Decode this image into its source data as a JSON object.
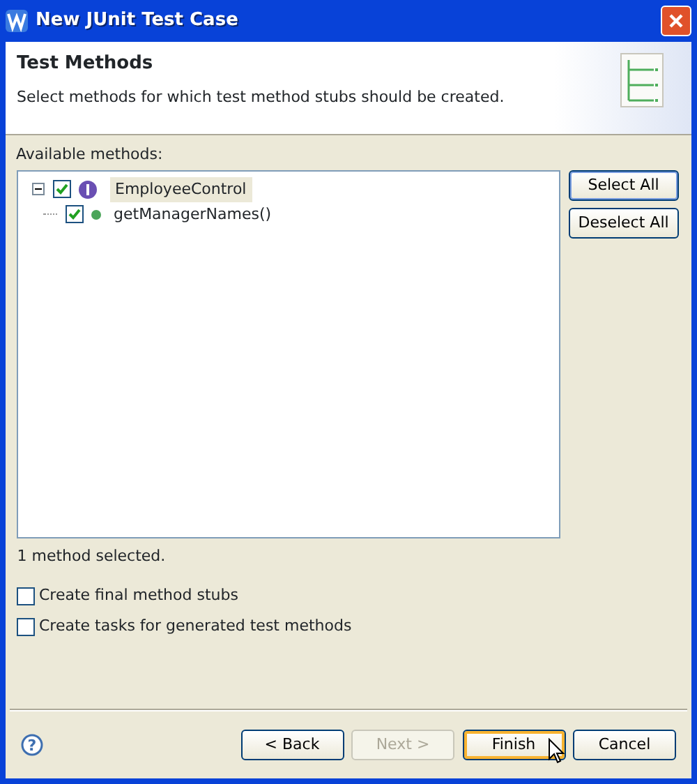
{
  "window": {
    "title": "New JUnit Test Case"
  },
  "header": {
    "title": "Test Methods",
    "description": "Select methods for which test method stubs should be created."
  },
  "methods": {
    "label": "Available methods:",
    "tree": [
      {
        "kind": "interface",
        "label": "EmployeeControl",
        "checked": true,
        "expanded": true,
        "selected": true,
        "children": [
          {
            "kind": "method",
            "label": "getManagerNames()",
            "checked": true,
            "selected": false
          }
        ]
      }
    ]
  },
  "side_buttons": [
    {
      "label": "Select All",
      "default": true
    },
    {
      "label": "Deselect All",
      "default": false
    }
  ],
  "status": "1 method selected.",
  "help": "?",
  "options": [
    {
      "label": "Create final method stubs",
      "checked": false
    },
    {
      "label": "Create tasks for generated test methods",
      "checked": false
    }
  ],
  "buttons": [
    {
      "label": "< Back",
      "disabled": false,
      "default": false
    },
    {
      "label": "Next >",
      "disabled": true,
      "default": false
    },
    {
      "label": "Finish",
      "disabled": false,
      "default": true
    },
    {
      "label": "Cancel",
      "disabled": false,
      "default": false
    }
  ]
}
